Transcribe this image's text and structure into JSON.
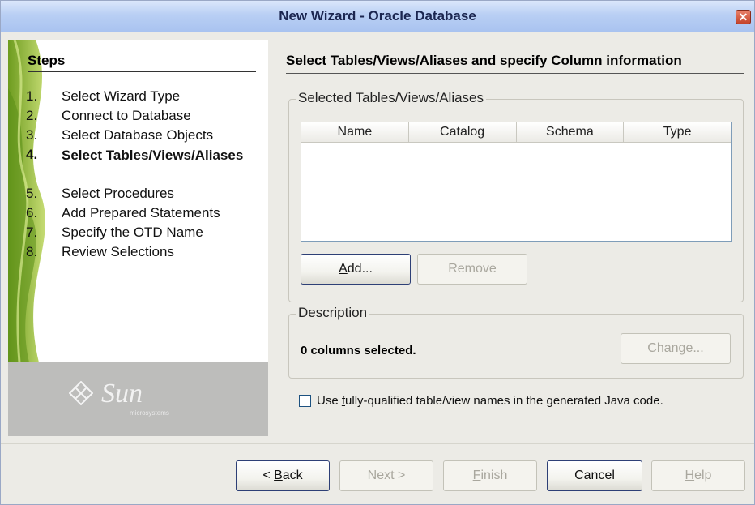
{
  "window": {
    "title": "New Wizard - Oracle Database"
  },
  "steps": {
    "title": "Steps",
    "items": [
      {
        "num": "1.",
        "label": "Select Wizard Type"
      },
      {
        "num": "2.",
        "label": "Connect to Database"
      },
      {
        "num": "3.",
        "label": "Select Database Objects"
      },
      {
        "num": "4.",
        "label": "Select Tables/Views/Aliases"
      },
      {
        "num": "5.",
        "label": "Select Procedures"
      },
      {
        "num": "6.",
        "label": "Add Prepared Statements"
      },
      {
        "num": "7.",
        "label": "Specify the OTD Name"
      },
      {
        "num": "8.",
        "label": "Review Selections"
      }
    ],
    "active_index": 3
  },
  "branding": {
    "logo": "Sun",
    "sub": "microsystems"
  },
  "main": {
    "title": "Select Tables/Views/Aliases and specify Column information",
    "selected_group_label": "Selected Tables/Views/Aliases",
    "table_columns": [
      "Name",
      "Catalog",
      "Schema",
      "Type"
    ],
    "add_button": {
      "pre": "",
      "mnemonic": "A",
      "post": "dd..."
    },
    "remove_button": "Remove",
    "description_group_label": "Description",
    "description_text": "0 columns selected.",
    "change_button": "Change...",
    "checkbox": {
      "pre": "Use ",
      "mnemonic": "f",
      "post": "ully-qualified table/view names in the generated Java code.",
      "checked": false
    }
  },
  "footer": {
    "back": {
      "pre": "< ",
      "mnemonic": "B",
      "post": "ack"
    },
    "next": "Next >",
    "finish": {
      "pre": "",
      "mnemonic": "F",
      "post": "inish"
    },
    "cancel": "Cancel",
    "help": {
      "pre": "",
      "mnemonic": "H",
      "post": "elp"
    }
  },
  "icons": {
    "close": "close-icon",
    "sun_logo": "sun-diamond-icon"
  }
}
